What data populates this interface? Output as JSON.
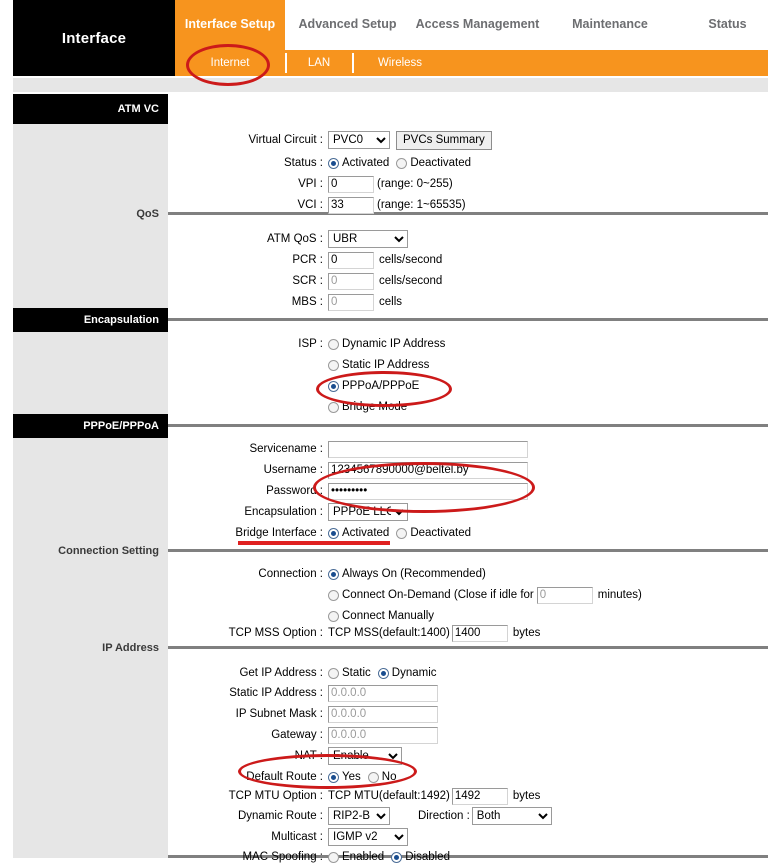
{
  "header": {
    "brand": "Interface",
    "main_tabs": [
      {
        "label": "Interface Setup",
        "active": true
      },
      {
        "label": "Advanced Setup",
        "active": false
      },
      {
        "label": "Access Management",
        "active": false
      },
      {
        "label": "Maintenance",
        "active": false
      },
      {
        "label": "Status",
        "active": false
      }
    ],
    "sub_tabs": [
      {
        "label": "Internet",
        "active": true
      },
      {
        "label": "LAN",
        "active": false
      },
      {
        "label": "Wireless",
        "active": false
      }
    ]
  },
  "sections": {
    "atm_vc": "ATM VC",
    "qos": "QoS",
    "encapsulation": "Encapsulation",
    "pppoe_pppoa": "PPPoE/PPPoA",
    "connection_setting": "Connection Setting",
    "ip_address": "IP Address"
  },
  "atm_vc": {
    "virtual_circuit_label": "Virtual Circuit :",
    "virtual_circuit_value": "PVC0",
    "pvcs_summary_button": "PVCs Summary",
    "status_label": "Status :",
    "status_activated": "Activated",
    "status_deactivated": "Deactivated",
    "status_selected": "Activated",
    "vpi_label": "VPI :",
    "vpi_value": "0",
    "vpi_range": "(range: 0~255)",
    "vci_label": "VCI :",
    "vci_value": "33",
    "vci_range": "(range: 1~65535)"
  },
  "qos": {
    "atm_qos_label": "ATM QoS :",
    "atm_qos_value": "UBR",
    "pcr_label": "PCR :",
    "pcr_value": "0",
    "pcr_unit": "cells/second",
    "scr_label": "SCR :",
    "scr_value": "0",
    "scr_unit": "cells/second",
    "mbs_label": "MBS :",
    "mbs_value": "0",
    "mbs_unit": "cells"
  },
  "encapsulation": {
    "isp_label": "ISP :",
    "options": [
      "Dynamic IP Address",
      "Static IP Address",
      "PPPoA/PPPoE",
      "Bridge Mode"
    ],
    "selected": "PPPoA/PPPoE"
  },
  "pppoe": {
    "servicename_label": "Servicename :",
    "servicename_value": "",
    "username_label": "Username :",
    "username_value": "1234567890000@beltel.by",
    "password_label": "Password :",
    "password_value": "•••••••••",
    "encapsulation_label": "Encapsulation :",
    "encapsulation_value": "PPPoE LLC",
    "bridge_interface_label": "Bridge Interface :",
    "bridge_activated": "Activated",
    "bridge_deactivated": "Deactivated",
    "bridge_selected": "Activated"
  },
  "connection": {
    "connection_label": "Connection :",
    "always_on": "Always On (Recommended)",
    "on_demand_pre": "Connect On-Demand (Close if idle for",
    "on_demand_value": "0",
    "on_demand_post": "minutes)",
    "connect_manually": "Connect Manually",
    "selected": "Always On (Recommended)",
    "tcp_mss_label": "TCP MSS Option :",
    "tcp_mss_pre": "TCP MSS(default:1400)",
    "tcp_mss_value": "1400",
    "tcp_mss_unit": "bytes"
  },
  "ip": {
    "get_ip_label": "Get IP Address :",
    "get_ip_static": "Static",
    "get_ip_dynamic": "Dynamic",
    "get_ip_selected": "Dynamic",
    "static_ip_label": "Static IP Address :",
    "static_ip_value": "0.0.0.0",
    "subnet_label": "IP Subnet Mask :",
    "subnet_value": "0.0.0.0",
    "gateway_label": "Gateway :",
    "gateway_value": "0.0.0.0",
    "nat_label": "NAT :",
    "nat_value": "Enable",
    "default_route_label": "Default Route :",
    "default_route_yes": "Yes",
    "default_route_no": "No",
    "default_route_selected": "Yes",
    "tcp_mtu_label": "TCP MTU Option :",
    "tcp_mtu_pre": "TCP MTU(default:1492)",
    "tcp_mtu_value": "1492",
    "tcp_mtu_unit": "bytes",
    "dynamic_route_label": "Dynamic Route :",
    "dynamic_route_value": "RIP2-B",
    "direction_label": "Direction :",
    "direction_value": "Both",
    "multicast_label": "Multicast :",
    "multicast_value": "IGMP v2",
    "mac_spoofing_label": "MAC Spoofing :",
    "mac_enabled": "Enabled",
    "mac_disabled": "Disabled",
    "mac_selected": "Disabled"
  },
  "colors": {
    "accent": "#f7941e",
    "bar": "#000000",
    "panel": "#e6e6e6",
    "annotation": "#cc1a1a"
  }
}
